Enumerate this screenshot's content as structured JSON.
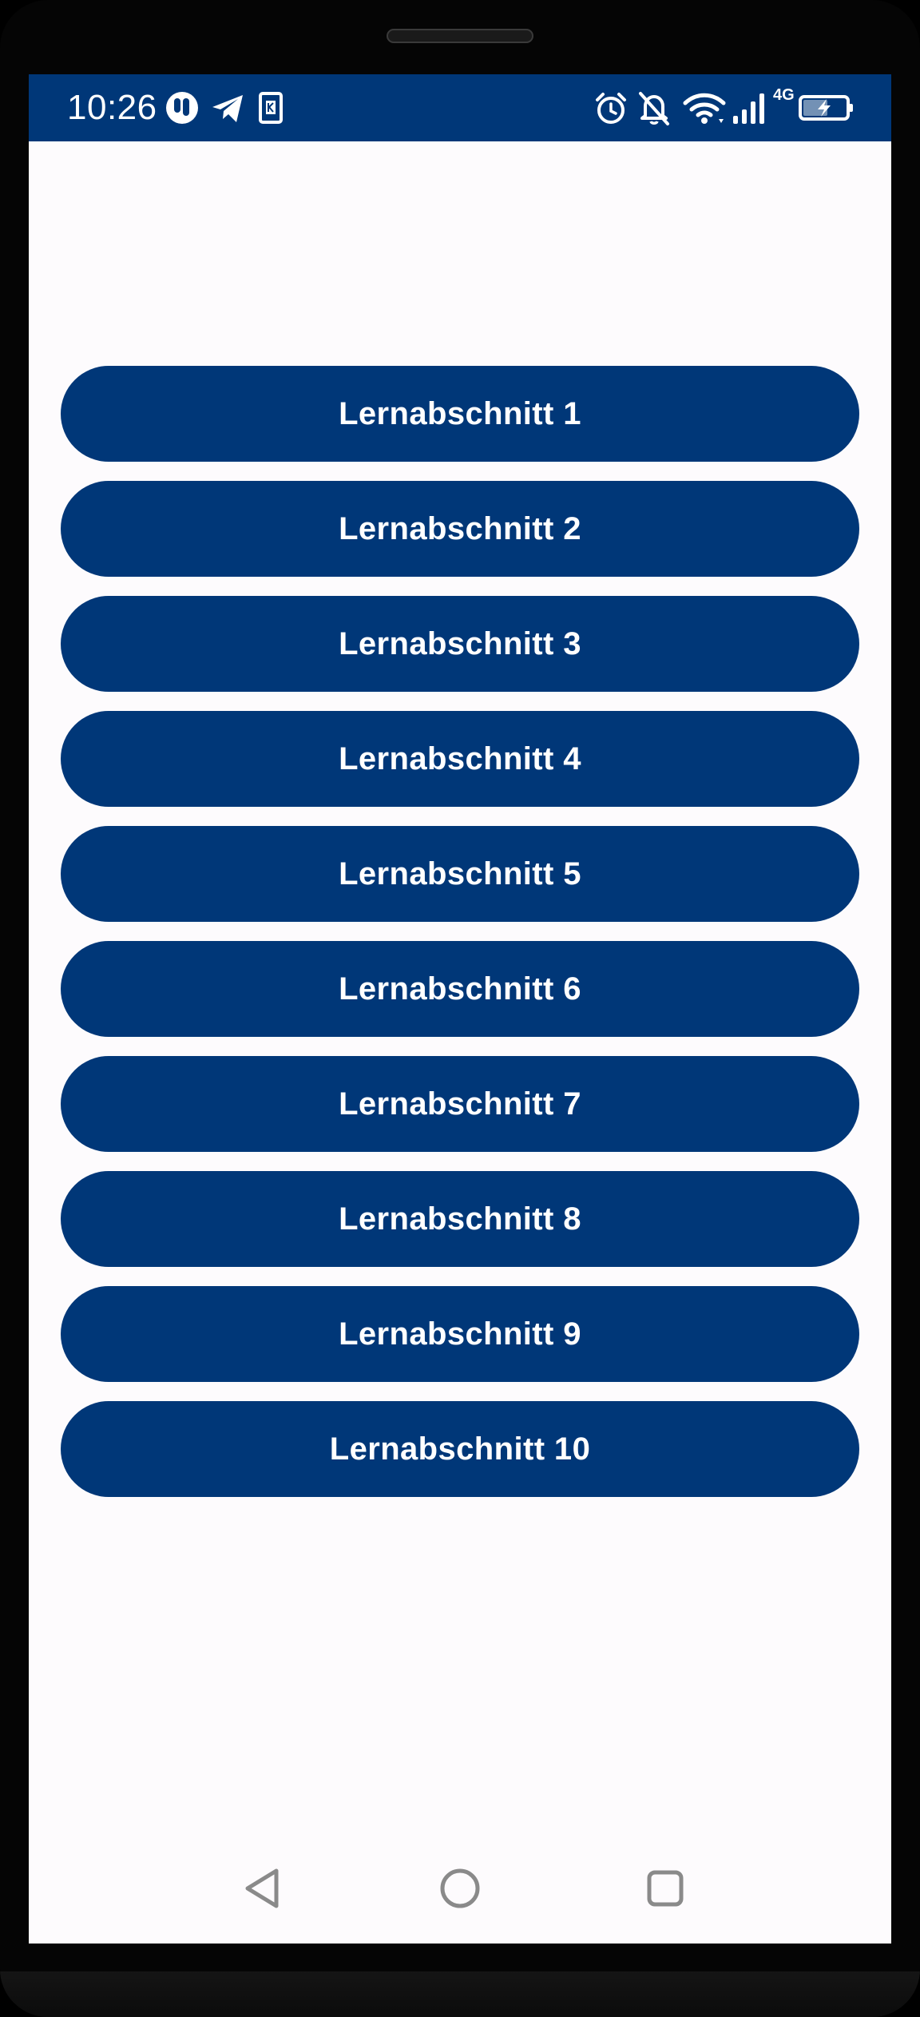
{
  "status_bar": {
    "time": "10:26",
    "network_label": "4G",
    "background_color": "#003778",
    "left_icons": [
      "app-circle-icon",
      "telegram-icon",
      "sim-card-icon"
    ],
    "right_icons": [
      "alarm-icon",
      "bell-off-icon",
      "wifi-icon",
      "signal-icon",
      "battery-charging-icon"
    ]
  },
  "lessons": {
    "button_color": "#003778",
    "items": [
      {
        "label": "Lernabschnitt 1"
      },
      {
        "label": "Lernabschnitt 2"
      },
      {
        "label": "Lernabschnitt 3"
      },
      {
        "label": "Lernabschnitt 4"
      },
      {
        "label": "Lernabschnitt 5"
      },
      {
        "label": "Lernabschnitt 6"
      },
      {
        "label": "Lernabschnitt 7"
      },
      {
        "label": "Lernabschnitt 8"
      },
      {
        "label": "Lernabschnitt 9"
      },
      {
        "label": "Lernabschnitt 10"
      }
    ]
  },
  "nav_bar": {
    "buttons": [
      "back-icon",
      "home-icon",
      "recents-icon"
    ]
  }
}
